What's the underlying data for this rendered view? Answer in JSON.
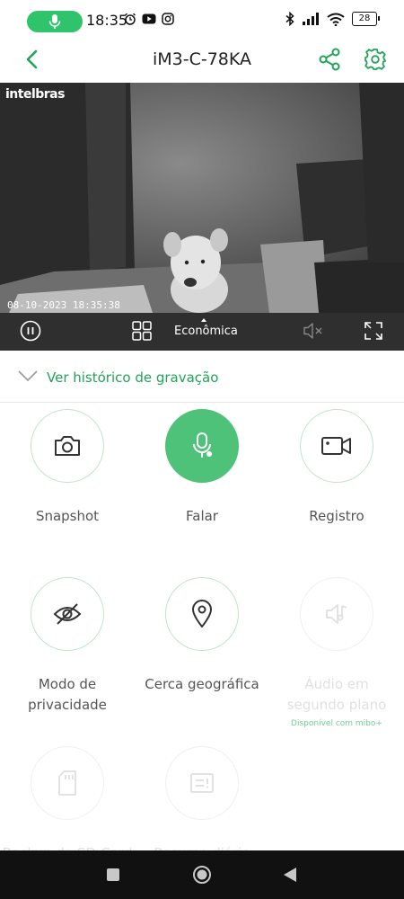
{
  "status_bar": {
    "time": "18:35",
    "battery": "28",
    "icons_left": [
      "alarm-icon",
      "youtube-icon",
      "instagram-icon"
    ],
    "icons_right": [
      "bluetooth-icon",
      "signal-icon",
      "wifi-icon"
    ]
  },
  "header": {
    "title": "iM3-C-78KA",
    "accent_color": "#22a35a"
  },
  "video": {
    "brand": "intelbras",
    "timestamp": "08-10-2023 18:35:38"
  },
  "controls": {
    "quality": "Econômica"
  },
  "history": {
    "label": "Ver histórico de gravação"
  },
  "actions": [
    {
      "label": "Snapshot",
      "icon": "camera-icon"
    },
    {
      "label": "Falar",
      "icon": "microphone-icon"
    },
    {
      "label": "Registro",
      "icon": "video-record-icon"
    },
    {
      "label": "Modo de privacidade",
      "icon": "eye-off-icon"
    },
    {
      "label": "Cerca geográfica",
      "icon": "location-pin-icon"
    },
    {
      "label": "Áudio em segundo plano",
      "icon": "background-audio-icon",
      "note": "Disponível com mibo+"
    },
    {
      "label": "Backup do SD-Card",
      "icon": "sd-card-icon"
    },
    {
      "label": "Resumo diário",
      "icon": "daily-summary-icon"
    }
  ]
}
